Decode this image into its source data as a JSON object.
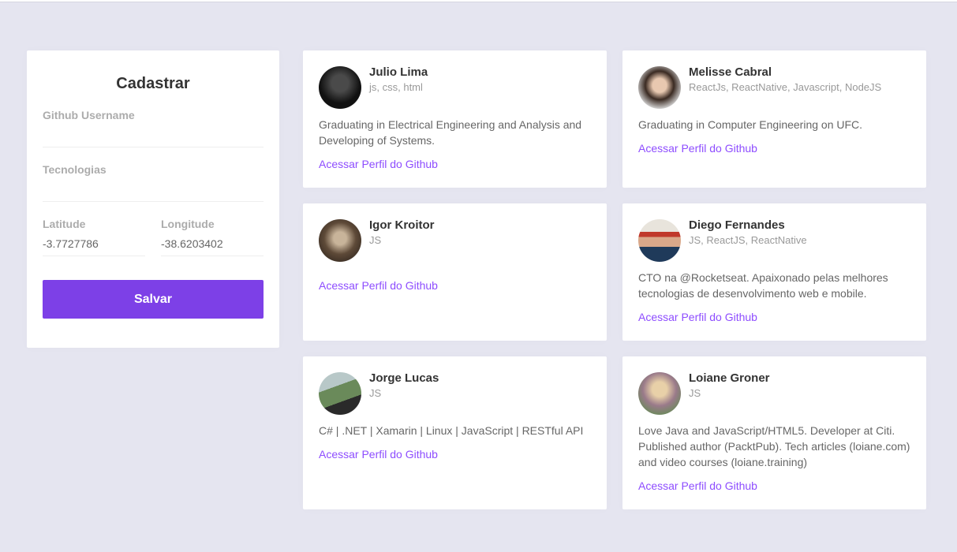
{
  "form": {
    "title": "Cadastrar",
    "github_username": {
      "label": "Github Username",
      "value": ""
    },
    "techs": {
      "label": "Tecnologias",
      "value": ""
    },
    "latitude": {
      "label": "Latitude",
      "value": "-3.7727786"
    },
    "longitude": {
      "label": "Longitude",
      "value": "-38.6203402"
    },
    "submit_label": "Salvar"
  },
  "colors": {
    "accent": "#7d40e7",
    "link": "#8e4dff",
    "background": "#e5e5f0"
  },
  "devs": [
    {
      "name": "Julio Lima",
      "techs": "js, css, html",
      "bio": "Graduating in Electrical Engineering and Analysis and Developing of Systems.",
      "link": "Acessar Perfil do Github",
      "avatar_color": "#1a1a1a"
    },
    {
      "name": "Melisse Cabral",
      "techs": "ReactJs, ReactNative, Javascript, NodeJS",
      "bio": "Graduating in Computer Engineering on UFC.",
      "link": "Acessar Perfil do Github",
      "avatar_color": "#5a4a3f"
    },
    {
      "name": "Igor Kroitor",
      "techs": "JS",
      "bio": "",
      "link": "Acessar Perfil do Github",
      "avatar_color": "#6b5a46"
    },
    {
      "name": "Diego Fernandes",
      "techs": "JS, ReactJS, ReactNative",
      "bio": "CTO na @Rocketseat. Apaixonado pelas melhores tecnologias de desenvolvimento web e mobile.",
      "link": "Acessar Perfil do Github",
      "avatar_color": "#5b8a5a"
    },
    {
      "name": "Jorge Lucas",
      "techs": "JS",
      "bio": "C# | .NET | Xamarin | Linux | JavaScript | RESTful API",
      "link": "Acessar Perfil do Github",
      "avatar_color": "#5d7a55"
    },
    {
      "name": "Loiane Groner",
      "techs": "JS",
      "bio": "Love Java and JavaScript/HTML5. Developer at Citi. Published author (PacktPub). Tech articles (loiane.com) and video courses (loiane.training)",
      "link": "Acessar Perfil do Github",
      "avatar_color": "#8a6e8a"
    }
  ]
}
